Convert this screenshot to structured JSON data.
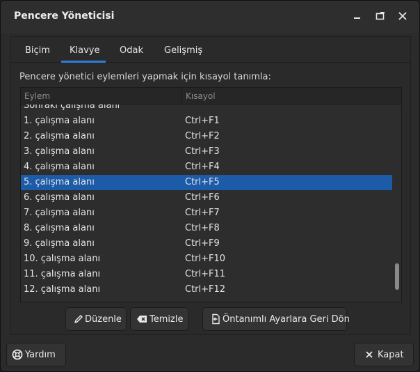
{
  "window": {
    "title": "Pencere Yöneticisi"
  },
  "tabs": [
    {
      "label": "Biçim"
    },
    {
      "label": "Klavye"
    },
    {
      "label": "Odak"
    },
    {
      "label": "Gelişmiş"
    }
  ],
  "active_tab": "Klavye",
  "description": "Pencere yönetici eylemleri yapmak için kısayol tanımla:",
  "table": {
    "headers": {
      "action": "Eylem",
      "shortcut": "Kısayol"
    },
    "partial_top_row": {
      "action": "Sonraki çalışma alanı"
    },
    "rows": [
      {
        "action": "1. çalışma alanı",
        "shortcut": "Ctrl+F1"
      },
      {
        "action": "2. çalışma alanı",
        "shortcut": "Ctrl+F2"
      },
      {
        "action": "3. çalışma alanı",
        "shortcut": "Ctrl+F3"
      },
      {
        "action": "4. çalışma alanı",
        "shortcut": "Ctrl+F4"
      },
      {
        "action": "5. çalışma alanı",
        "shortcut": "Ctrl+F5"
      },
      {
        "action": "6. çalışma alanı",
        "shortcut": "Ctrl+F6"
      },
      {
        "action": "7. çalışma alanı",
        "shortcut": "Ctrl+F7"
      },
      {
        "action": "8. çalışma alanı",
        "shortcut": "Ctrl+F8"
      },
      {
        "action": "9. çalışma alanı",
        "shortcut": "Ctrl+F9"
      },
      {
        "action": "10. çalışma alanı",
        "shortcut": "Ctrl+F10"
      },
      {
        "action": "11. çalışma alanı",
        "shortcut": "Ctrl+F11"
      },
      {
        "action": "12. çalışma alanı",
        "shortcut": "Ctrl+F12"
      }
    ],
    "selected_row": "5. çalışma alanı"
  },
  "actions": {
    "edit": "Düzenle",
    "clear": "Temizle",
    "reset": "Öntanımlı Ayarlara Geri Dön"
  },
  "footer": {
    "help": "Yardım",
    "close": "Kapat"
  },
  "colors": {
    "accent": "#2f7bd6",
    "selection": "#1c5ba8",
    "background": "#2b2b2b"
  },
  "icons": {
    "minimize": "minimize-icon",
    "maximize": "maximize-icon",
    "close": "close-icon",
    "edit": "pencil-icon",
    "clear": "backspace-icon",
    "reset": "document-revert-icon",
    "help": "lifebuoy-icon",
    "close_button": "close-icon"
  }
}
